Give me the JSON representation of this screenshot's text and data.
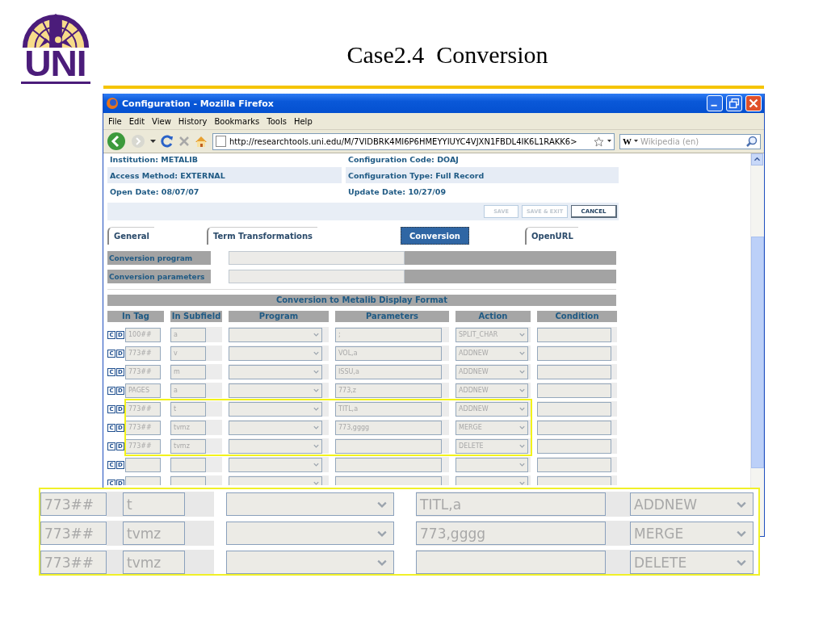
{
  "slide": {
    "logo_text": "UNI",
    "title": "Case2.4  Conversion"
  },
  "window": {
    "title": "Configuration - Mozilla Firefox"
  },
  "menu": [
    "File",
    "Edit",
    "View",
    "History",
    "Bookmarks",
    "Tools",
    "Help"
  ],
  "address_bar": {
    "value": "http://researchtools.uni.edu/M/7VIDBRK4MI6P6HMEYYIUYC4VJXN1FBDL4IK6L1RAKK6>"
  },
  "search": {
    "engine": "W",
    "placeholder": "Wikipedia (en)"
  },
  "info": [
    [
      "Institution: METALIB",
      "Configuration Code: DOAJ"
    ],
    [
      "Access Method: EXTERNAL",
      "Configuration Type: Full Record"
    ],
    [
      "Open Date: 08/07/07",
      "Update Date: 10/27/09"
    ]
  ],
  "actions": [
    {
      "label": "SAVE",
      "disabled": true
    },
    {
      "label": "SAVE & EXIT",
      "disabled": true
    },
    {
      "label": "CANCEL",
      "disabled": false
    }
  ],
  "tabs": [
    {
      "label": "General",
      "selected": false
    },
    {
      "label": "Term Transformations",
      "selected": false
    },
    {
      "label": "Conversion",
      "selected": true
    },
    {
      "label": "OpenURL",
      "selected": false
    }
  ],
  "fields": [
    {
      "label": "Conversion program"
    },
    {
      "label": "Conversion parameters"
    }
  ],
  "table": {
    "title": "Conversion to Metalib Display Format",
    "columns": [
      "In Tag",
      "In Subfield",
      "Program",
      "Parameters",
      "Action",
      "Condition"
    ],
    "rows": [
      {
        "buttons": [
          "C",
          "D"
        ],
        "in_tag": "100##",
        "in_subfield": "a",
        "parameters": ";",
        "action": "SPLIT_CHAR",
        "highlighted": false
      },
      {
        "buttons": [
          "C",
          "D"
        ],
        "in_tag": "773##",
        "in_subfield": "v",
        "parameters": "VOL,a",
        "action": "ADDNEW",
        "highlighted": false
      },
      {
        "buttons": [
          "C",
          "D"
        ],
        "in_tag": "773##",
        "in_subfield": "m",
        "parameters": "ISSU,a",
        "action": "ADDNEW",
        "highlighted": false
      },
      {
        "buttons": [
          "C",
          "D"
        ],
        "in_tag": "PAGES",
        "in_subfield": "a",
        "parameters": "773,z",
        "action": "ADDNEW",
        "highlighted": false
      },
      {
        "buttons": [
          "C",
          "D"
        ],
        "in_tag": "773##",
        "in_subfield": "t",
        "parameters": "TITL,a",
        "action": "ADDNEW",
        "highlighted": true
      },
      {
        "buttons": [
          "C",
          "D"
        ],
        "in_tag": "773##",
        "in_subfield": "tvmz",
        "parameters": "773,gggg",
        "action": "MERGE",
        "highlighted": true
      },
      {
        "buttons": [
          "C",
          "D"
        ],
        "in_tag": "773##",
        "in_subfield": "tvmz",
        "action": "DELETE",
        "highlighted": true
      },
      {
        "buttons": [
          "C",
          "D"
        ],
        "highlighted": false
      },
      {
        "buttons": [
          "C",
          "D"
        ],
        "highlighted": false
      }
    ]
  },
  "zoom_inset": {
    "rows": [
      {
        "in_tag": "773##",
        "in_subfield": "t",
        "parameters": "TITL,a",
        "action": "ADDNEW"
      },
      {
        "in_tag": "773##",
        "in_subfield": "tvmz",
        "parameters": "773,gggg",
        "action": "MERGE"
      },
      {
        "in_tag": "773##",
        "in_subfield": "tvmz",
        "action": "DELETE"
      }
    ]
  }
}
